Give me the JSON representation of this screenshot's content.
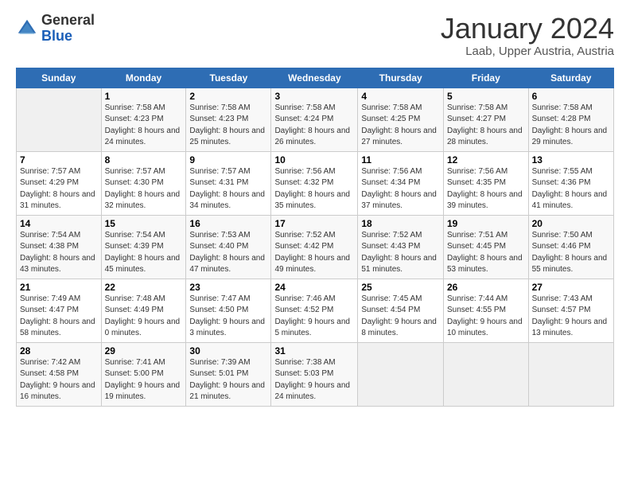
{
  "logo": {
    "general": "General",
    "blue": "Blue"
  },
  "header": {
    "month": "January 2024",
    "location": "Laab, Upper Austria, Austria"
  },
  "weekdays": [
    "Sunday",
    "Monday",
    "Tuesday",
    "Wednesday",
    "Thursday",
    "Friday",
    "Saturday"
  ],
  "weeks": [
    [
      {
        "day": "",
        "sunrise": "",
        "sunset": "",
        "daylight": ""
      },
      {
        "day": "1",
        "sunrise": "7:58 AM",
        "sunset": "4:23 PM",
        "daylight": "8 hours and 24 minutes."
      },
      {
        "day": "2",
        "sunrise": "7:58 AM",
        "sunset": "4:23 PM",
        "daylight": "8 hours and 25 minutes."
      },
      {
        "day": "3",
        "sunrise": "7:58 AM",
        "sunset": "4:24 PM",
        "daylight": "8 hours and 26 minutes."
      },
      {
        "day": "4",
        "sunrise": "7:58 AM",
        "sunset": "4:25 PM",
        "daylight": "8 hours and 27 minutes."
      },
      {
        "day": "5",
        "sunrise": "7:58 AM",
        "sunset": "4:27 PM",
        "daylight": "8 hours and 28 minutes."
      },
      {
        "day": "6",
        "sunrise": "7:58 AM",
        "sunset": "4:28 PM",
        "daylight": "8 hours and 29 minutes."
      }
    ],
    [
      {
        "day": "7",
        "sunrise": "7:57 AM",
        "sunset": "4:29 PM",
        "daylight": "8 hours and 31 minutes."
      },
      {
        "day": "8",
        "sunrise": "7:57 AM",
        "sunset": "4:30 PM",
        "daylight": "8 hours and 32 minutes."
      },
      {
        "day": "9",
        "sunrise": "7:57 AM",
        "sunset": "4:31 PM",
        "daylight": "8 hours and 34 minutes."
      },
      {
        "day": "10",
        "sunrise": "7:56 AM",
        "sunset": "4:32 PM",
        "daylight": "8 hours and 35 minutes."
      },
      {
        "day": "11",
        "sunrise": "7:56 AM",
        "sunset": "4:34 PM",
        "daylight": "8 hours and 37 minutes."
      },
      {
        "day": "12",
        "sunrise": "7:56 AM",
        "sunset": "4:35 PM",
        "daylight": "8 hours and 39 minutes."
      },
      {
        "day": "13",
        "sunrise": "7:55 AM",
        "sunset": "4:36 PM",
        "daylight": "8 hours and 41 minutes."
      }
    ],
    [
      {
        "day": "14",
        "sunrise": "7:54 AM",
        "sunset": "4:38 PM",
        "daylight": "8 hours and 43 minutes."
      },
      {
        "day": "15",
        "sunrise": "7:54 AM",
        "sunset": "4:39 PM",
        "daylight": "8 hours and 45 minutes."
      },
      {
        "day": "16",
        "sunrise": "7:53 AM",
        "sunset": "4:40 PM",
        "daylight": "8 hours and 47 minutes."
      },
      {
        "day": "17",
        "sunrise": "7:52 AM",
        "sunset": "4:42 PM",
        "daylight": "8 hours and 49 minutes."
      },
      {
        "day": "18",
        "sunrise": "7:52 AM",
        "sunset": "4:43 PM",
        "daylight": "8 hours and 51 minutes."
      },
      {
        "day": "19",
        "sunrise": "7:51 AM",
        "sunset": "4:45 PM",
        "daylight": "8 hours and 53 minutes."
      },
      {
        "day": "20",
        "sunrise": "7:50 AM",
        "sunset": "4:46 PM",
        "daylight": "8 hours and 55 minutes."
      }
    ],
    [
      {
        "day": "21",
        "sunrise": "7:49 AM",
        "sunset": "4:47 PM",
        "daylight": "8 hours and 58 minutes."
      },
      {
        "day": "22",
        "sunrise": "7:48 AM",
        "sunset": "4:49 PM",
        "daylight": "9 hours and 0 minutes."
      },
      {
        "day": "23",
        "sunrise": "7:47 AM",
        "sunset": "4:50 PM",
        "daylight": "9 hours and 3 minutes."
      },
      {
        "day": "24",
        "sunrise": "7:46 AM",
        "sunset": "4:52 PM",
        "daylight": "9 hours and 5 minutes."
      },
      {
        "day": "25",
        "sunrise": "7:45 AM",
        "sunset": "4:54 PM",
        "daylight": "9 hours and 8 minutes."
      },
      {
        "day": "26",
        "sunrise": "7:44 AM",
        "sunset": "4:55 PM",
        "daylight": "9 hours and 10 minutes."
      },
      {
        "day": "27",
        "sunrise": "7:43 AM",
        "sunset": "4:57 PM",
        "daylight": "9 hours and 13 minutes."
      }
    ],
    [
      {
        "day": "28",
        "sunrise": "7:42 AM",
        "sunset": "4:58 PM",
        "daylight": "9 hours and 16 minutes."
      },
      {
        "day": "29",
        "sunrise": "7:41 AM",
        "sunset": "5:00 PM",
        "daylight": "9 hours and 19 minutes."
      },
      {
        "day": "30",
        "sunrise": "7:39 AM",
        "sunset": "5:01 PM",
        "daylight": "9 hours and 21 minutes."
      },
      {
        "day": "31",
        "sunrise": "7:38 AM",
        "sunset": "5:03 PM",
        "daylight": "9 hours and 24 minutes."
      },
      {
        "day": "",
        "sunrise": "",
        "sunset": "",
        "daylight": ""
      },
      {
        "day": "",
        "sunrise": "",
        "sunset": "",
        "daylight": ""
      },
      {
        "day": "",
        "sunrise": "",
        "sunset": "",
        "daylight": ""
      }
    ]
  ]
}
